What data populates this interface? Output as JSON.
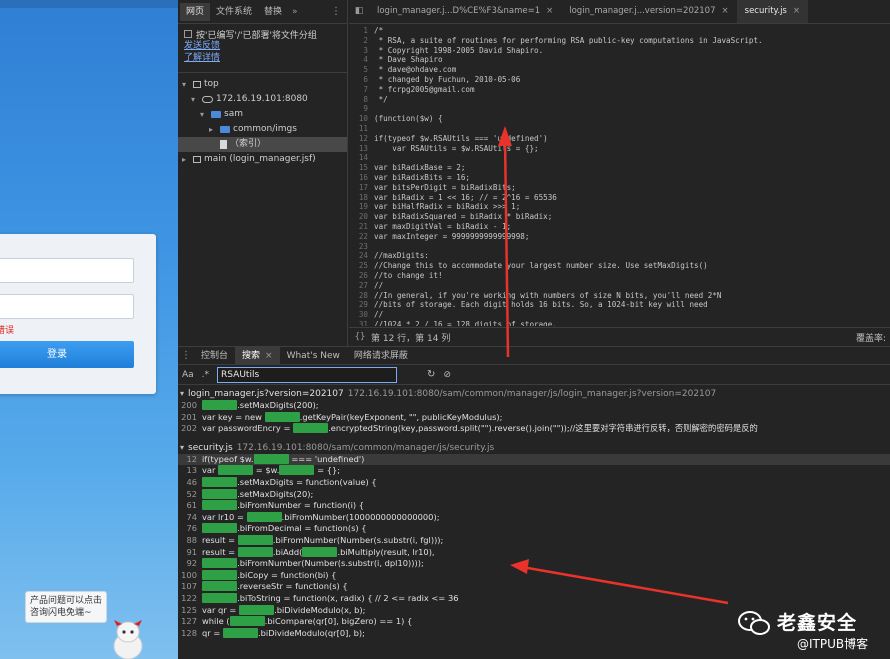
{
  "page": {
    "login_button": "登录",
    "login_error": "错误",
    "help_text": "产品问题可以点击咨询闪电免端~"
  },
  "navigator": {
    "tabs": [
      "网页",
      "文件系统",
      "替换"
    ],
    "more": "»",
    "group_label": "按'已编写'/'已部署'将文件分组",
    "links": [
      "发送反馈",
      "了解详情"
    ],
    "tree": [
      {
        "label": "top",
        "type": "frame",
        "indent": 0,
        "open": true
      },
      {
        "label": "172.16.19.101:8080",
        "type": "cloud",
        "indent": 1,
        "open": true
      },
      {
        "label": "sam",
        "type": "folder",
        "indent": 2,
        "open": true
      },
      {
        "label": "common/imgs",
        "type": "folder",
        "indent": 3,
        "open": false
      },
      {
        "label": "（索引）",
        "type": "file",
        "indent": 3,
        "open": null,
        "selected": true
      },
      {
        "label": "main (login_manager.jsf)",
        "type": "frame",
        "indent": 0,
        "open": false
      }
    ]
  },
  "editor": {
    "tabs": [
      {
        "label": "login_manager.j...D%CE%F3&name=1",
        "active": false
      },
      {
        "label": "login_manager.j...version=202107",
        "active": false
      },
      {
        "label": "security.js",
        "active": true
      }
    ],
    "close_glyph": "×",
    "lines": [
      {
        "n": "1",
        "t": "/*",
        "k": "com"
      },
      {
        "n": "2",
        "t": " * RSA, a suite of routines for performing RSA public-key computations in JavaScript.",
        "k": "com"
      },
      {
        "n": "3",
        "t": " * Copyright 1998-2005 David Shapiro.",
        "k": "com"
      },
      {
        "n": "4",
        "t": " * Dave Shapiro",
        "k": "com"
      },
      {
        "n": "5",
        "t": " * dave@ohdave.com",
        "k": "com"
      },
      {
        "n": "6",
        "t": " * changed by Fuchun, 2010-05-06",
        "k": "com"
      },
      {
        "n": "7",
        "t": " * fcrpg2005@gmail.com",
        "k": "com"
      },
      {
        "n": "8",
        "t": " */",
        "k": "com"
      },
      {
        "n": "9",
        "t": "",
        "k": "plain"
      },
      {
        "n": "10",
        "t": "(function($w) {",
        "k": "fn"
      },
      {
        "n": "11",
        "t": "",
        "k": "plain"
      },
      {
        "n": "12",
        "t": "if(typeof $w.RSAUtils === 'undefined')",
        "k": "kw"
      },
      {
        "n": "13",
        "t": "    var RSAUtils = $w.RSAUtils = {};",
        "k": "var"
      },
      {
        "n": "14",
        "t": "",
        "k": "plain"
      },
      {
        "n": "15",
        "t": "var biRadixBase = 2;",
        "k": "var"
      },
      {
        "n": "16",
        "t": "var biRadixBits = 16;",
        "k": "var"
      },
      {
        "n": "17",
        "t": "var bitsPerDigit = biRadixBits;",
        "k": "var"
      },
      {
        "n": "18",
        "t": "var biRadix = 1 << 16; // = 2^16 = 65536",
        "k": "var"
      },
      {
        "n": "19",
        "t": "var biHalfRadix = biRadix >>> 1;",
        "k": "var"
      },
      {
        "n": "20",
        "t": "var biRadixSquared = biRadix * biRadix;",
        "k": "var"
      },
      {
        "n": "21",
        "t": "var maxDigitVal = biRadix - 1;",
        "k": "var"
      },
      {
        "n": "22",
        "t": "var maxInteger = 9999999999999998;",
        "k": "var"
      },
      {
        "n": "23",
        "t": "",
        "k": "plain"
      },
      {
        "n": "24",
        "t": "//maxDigits:",
        "k": "com"
      },
      {
        "n": "25",
        "t": "//Change this to accommodate your largest number size. Use setMaxDigits()",
        "k": "com"
      },
      {
        "n": "26",
        "t": "//to change it!",
        "k": "com"
      },
      {
        "n": "27",
        "t": "//",
        "k": "com"
      },
      {
        "n": "28",
        "t": "//In general, if you're working with numbers of size N bits, you'll need 2*N",
        "k": "com"
      },
      {
        "n": "29",
        "t": "//bits of storage. Each digit holds 16 bits. So, a 1024-bit key will need",
        "k": "com"
      },
      {
        "n": "30",
        "t": "//",
        "k": "com"
      },
      {
        "n": "31",
        "t": "//1024 * 2 / 16 = 128 digits of storage.",
        "k": "com"
      }
    ],
    "status_braces": "{}",
    "status_pos": "第 12 行，第 14 列",
    "status_right": "覆盖率:"
  },
  "drawer": {
    "tabs": [
      {
        "label": "控制台",
        "active": false,
        "close": false
      },
      {
        "label": "搜索",
        "active": true,
        "close": true
      },
      {
        "label": "What's New",
        "active": false,
        "close": false
      },
      {
        "label": "网络请求屏蔽",
        "active": false,
        "close": false
      }
    ],
    "kebab": "⋮",
    "aa": "Aa",
    "regex": ".*",
    "query": "RSAUtils",
    "refresh_icon": "↻",
    "clear_icon": "⊘",
    "groups": [
      {
        "file": "login_manager.js?version=202107",
        "path": "172.16.19.101:8080/sam/common/manager/js/login_manager.js?version=202107",
        "lines": [
          {
            "n": "200",
            "parts": [
              "",
              "RSAUtils",
              ".setMaxDigits(200);"
            ]
          },
          {
            "n": "201",
            "parts": [
              "var key = new ",
              "RSAUtils",
              ".getKeyPair(keyExponent, \"\", publicKeyModulus);"
            ]
          },
          {
            "n": "202",
            "parts": [
              "var passwordEncry = ",
              "RSAUtils",
              ".encryptedString(key,password.split(\"\").reverse().join(\"\"));//这里要对字符串进行反转，否则解密的密码是反的"
            ]
          }
        ]
      },
      {
        "file": "security.js",
        "path": "172.16.19.101:8080/sam/common/manager/js/security.js",
        "lines": [
          {
            "n": "12",
            "parts": [
              "if(typeof $w.",
              "RSAUtils",
              " === 'undefined')"
            ],
            "selected": true
          },
          {
            "n": "13",
            "parts": [
              "var ",
              "RSAUtils",
              " = $w.",
              "RSAUtils",
              " = {};"
            ]
          },
          {
            "n": "46",
            "parts": [
              "",
              "RSAUtils",
              ".setMaxDigits = function(value) {"
            ]
          },
          {
            "n": "52",
            "parts": [
              "",
              "RSAUtils",
              ".setMaxDigits(20);"
            ]
          },
          {
            "n": "61",
            "parts": [
              "",
              "RSAUtils",
              ".biFromNumber = function(i) {"
            ]
          },
          {
            "n": "74",
            "parts": [
              "var lr10 = ",
              "RSAUtils",
              ".biFromNumber(1000000000000000);"
            ]
          },
          {
            "n": "76",
            "parts": [
              "",
              "RSAUtils",
              ".biFromDecimal = function(s) {"
            ]
          },
          {
            "n": "88",
            "parts": [
              "result = ",
              "RSAUtils",
              ".biFromNumber(Number(s.substr(i, fgl)));"
            ]
          },
          {
            "n": "91",
            "parts": [
              "result = ",
              "RSAUtils",
              ".biAdd(",
              "RSAUtils",
              ".biMultiply(result, lr10),"
            ]
          },
          {
            "n": "92",
            "parts": [
              "",
              "RSAUtils",
              ".biFromNumber(Number(s.substr(i, dpl10))));"
            ]
          },
          {
            "n": "100",
            "parts": [
              "",
              "RSAUtils",
              ".biCopy = function(bi) {"
            ]
          },
          {
            "n": "107",
            "parts": [
              "",
              "RSAUtils",
              ".reverseStr = function(s) {"
            ]
          },
          {
            "n": "122",
            "parts": [
              "",
              "RSAUtils",
              ".biToString = function(x, radix) { // 2 <= radix <= 36"
            ]
          },
          {
            "n": "125",
            "parts": [
              "var qr = ",
              "RSAUtils",
              ".biDivideModulo(x, b);"
            ]
          },
          {
            "n": "127",
            "parts": [
              "while (",
              "RSAUtils",
              ".biCompare(qr[0], bigZero) == 1) {"
            ]
          },
          {
            "n": "128",
            "parts": [
              "qr = ",
              "RSAUtils",
              ".biDivideModulo(qr[0], b);"
            ]
          }
        ]
      }
    ]
  },
  "watermark": {
    "title": "老鑫安全",
    "sub": "@ITPUB博客"
  },
  "colors": {
    "annotation": "#e8322a",
    "match": "#2fa046",
    "link": "#7cacf8"
  }
}
